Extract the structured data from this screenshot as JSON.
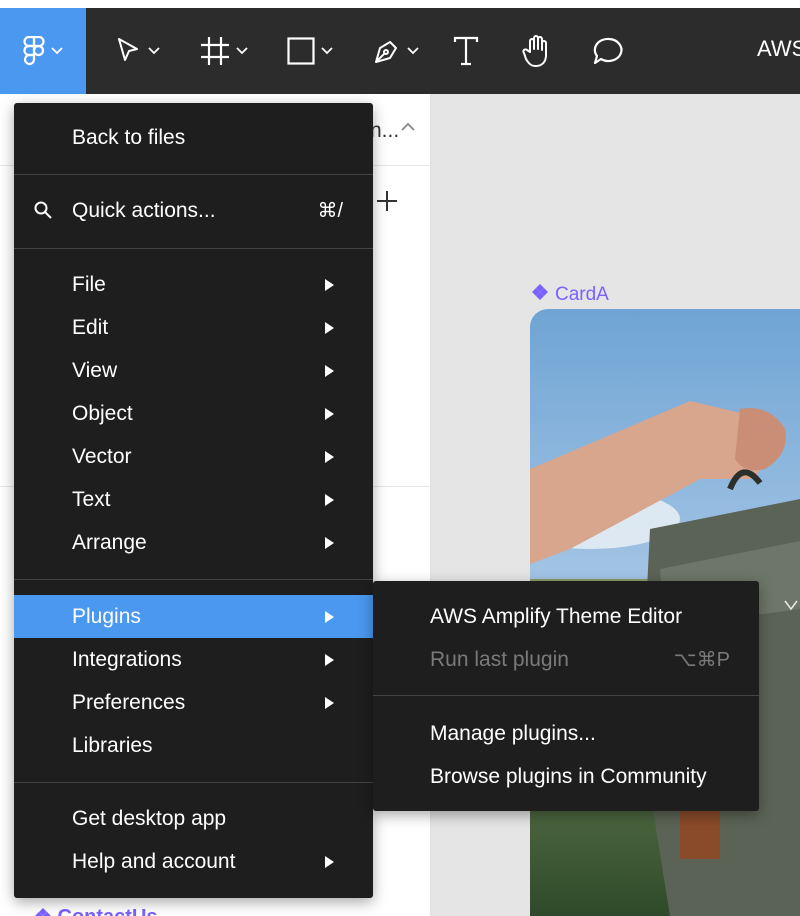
{
  "toolbar": {
    "tools": [
      {
        "name": "figma-menu",
        "icon": "figma-logo-icon"
      },
      {
        "name": "move-tool",
        "icon": "cursor-icon"
      },
      {
        "name": "frame-tool",
        "icon": "frame-icon"
      },
      {
        "name": "shape-tool",
        "icon": "rectangle-icon"
      },
      {
        "name": "pen-tool",
        "icon": "pen-icon"
      },
      {
        "name": "text-tool",
        "icon": "text-icon"
      },
      {
        "name": "hand-tool",
        "icon": "hand-icon"
      },
      {
        "name": "comment-tool",
        "icon": "comment-icon"
      }
    ],
    "title_fragment": "AWS",
    "accent": "#4a98ef",
    "background": "#2c2c2c"
  },
  "left_panel": {
    "page_fragment": "n...",
    "contact_label": "ContactUs"
  },
  "canvas": {
    "frame_label": "CardA",
    "frame_label_color": "#7b61ff"
  },
  "main_menu": {
    "back": "Back to files",
    "quick_actions": "Quick actions...",
    "quick_actions_shortcut": "⌘/",
    "items": [
      {
        "label": "File",
        "submenu": true
      },
      {
        "label": "Edit",
        "submenu": true
      },
      {
        "label": "View",
        "submenu": true
      },
      {
        "label": "Object",
        "submenu": true
      },
      {
        "label": "Vector",
        "submenu": true
      },
      {
        "label": "Text",
        "submenu": true
      },
      {
        "label": "Arrange",
        "submenu": true
      }
    ],
    "items2": [
      {
        "label": "Plugins",
        "submenu": true,
        "active": true
      },
      {
        "label": "Integrations",
        "submenu": true
      },
      {
        "label": "Preferences",
        "submenu": true
      },
      {
        "label": "Libraries",
        "submenu": false
      }
    ],
    "items3": [
      {
        "label": "Get desktop app",
        "submenu": false
      },
      {
        "label": "Help and account",
        "submenu": true
      }
    ]
  },
  "plugins_submenu": {
    "items": [
      {
        "label": "AWS Amplify Theme Editor",
        "disabled": false
      },
      {
        "label": "Run last plugin",
        "disabled": true,
        "shortcut": "⌥⌘P"
      }
    ],
    "items2": [
      {
        "label": "Manage plugins...",
        "disabled": false
      },
      {
        "label": "Browse plugins in Community",
        "disabled": false
      }
    ]
  }
}
